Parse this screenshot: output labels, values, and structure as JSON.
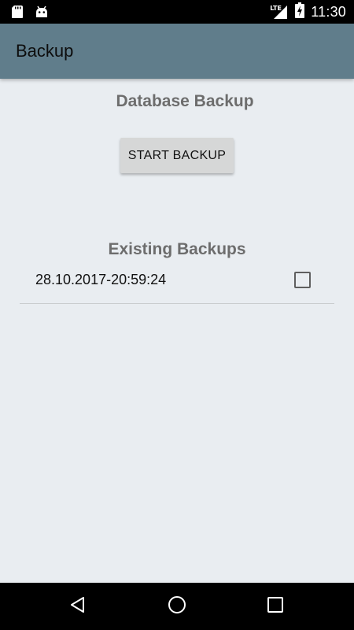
{
  "status_bar": {
    "network_label": "LTE",
    "time": "11:30",
    "left_icons": [
      "sd-card-icon",
      "android-icon"
    ],
    "right_icons": [
      "signal-icon",
      "battery-charging-icon"
    ]
  },
  "app_bar": {
    "title": "Backup",
    "color": "#607d8b"
  },
  "main": {
    "database_section_title": "Database Backup",
    "start_button_label": "START BACKUP",
    "existing_section_title": "Existing Backups",
    "backups": [
      {
        "date": "28.10.2017-20:59:24",
        "checked": false
      }
    ]
  },
  "nav_bar": {
    "buttons": [
      "back-icon",
      "home-icon",
      "recents-icon"
    ]
  },
  "colors": {
    "background": "#e9edf1",
    "app_bar": "#607d8b",
    "button": "#d6d7d7",
    "section_title": "#6d6d6d"
  }
}
